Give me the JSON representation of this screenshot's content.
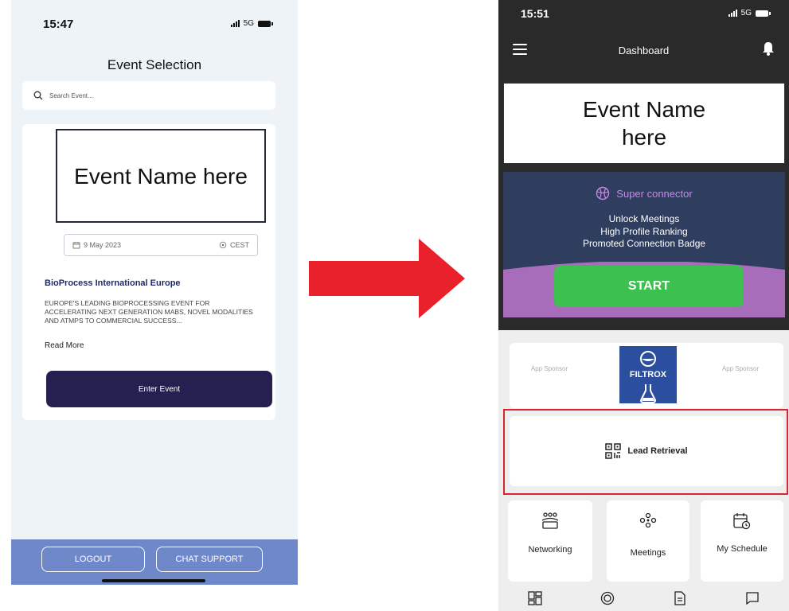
{
  "left_screen": {
    "status": {
      "time": "15:47",
      "network": "5G"
    },
    "title": "Event Selection",
    "search": {
      "placeholder": "Search Event..."
    },
    "event_name": "Event Name here",
    "date": "9 May 2023",
    "timezone": "CEST",
    "event_title": "BioProcess International Europe",
    "description": "EUROPE'S LEADING BIOPROCESSING EVENT FOR ACCELERATING NEXT GENERATION MABS, NOVEL MODALITIES AND ATMPS TO COMMERCIAL SUCCESS...",
    "read_more": "Read More",
    "enter_button": "Enter Event",
    "logout_button": "LOGOUT",
    "chat_button": "CHAT SUPPORT"
  },
  "right_screen": {
    "status": {
      "time": "15:51",
      "network": "5G"
    },
    "header_title": "Dashboard",
    "event_name": "Event Name here",
    "promo": {
      "heading": "Super connector",
      "line1": "Unlock Meetings",
      "line2": "High Profile Ranking",
      "line3": "Promoted Connection Badge",
      "start_button": "START"
    },
    "sponsors": {
      "left_placeholder": "App Sponsor",
      "logo_text": "FILTROX",
      "right_placeholder": "App Sponsor"
    },
    "lead_retrieval": "Lead Retrieval",
    "tiles": [
      "Networking",
      "Meetings",
      "My Schedule"
    ],
    "nav_icons": [
      "dashboard-icon",
      "circle-icon",
      "document-icon",
      "chat-icon"
    ]
  },
  "colors": {
    "arrow": "#e8212a",
    "highlight_outline": "#d9262e",
    "enter_button": "#25204f",
    "bottom_bar": "#6e88c9",
    "start_button": "#3cc04e",
    "promo_accent": "#c987e8"
  }
}
